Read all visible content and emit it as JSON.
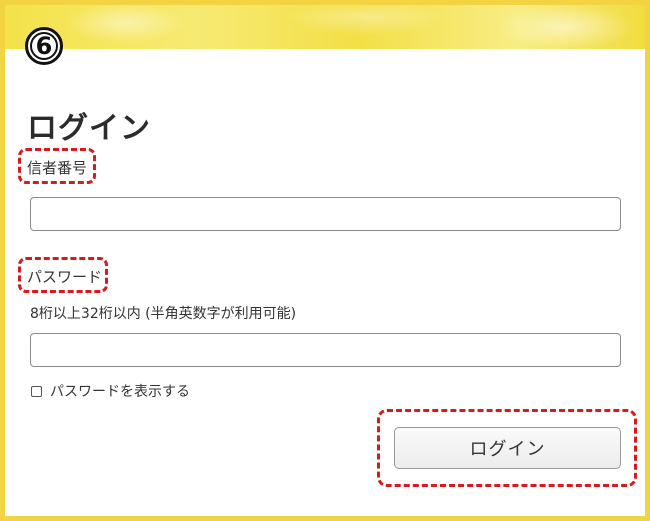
{
  "step": {
    "number": "6"
  },
  "page": {
    "title": "ログイン"
  },
  "form": {
    "account_label": "信者番号",
    "account_value": "",
    "password_label": "パスワード",
    "password_hint": "8桁以上32桁以内 (半角英数字が利用可能)",
    "password_value": "",
    "show_password_label": "パスワードを表示する",
    "show_password_checked": false,
    "submit_label": "ログイン"
  },
  "colors": {
    "frame": "#f2d341",
    "highlight": "#d91a1a"
  }
}
